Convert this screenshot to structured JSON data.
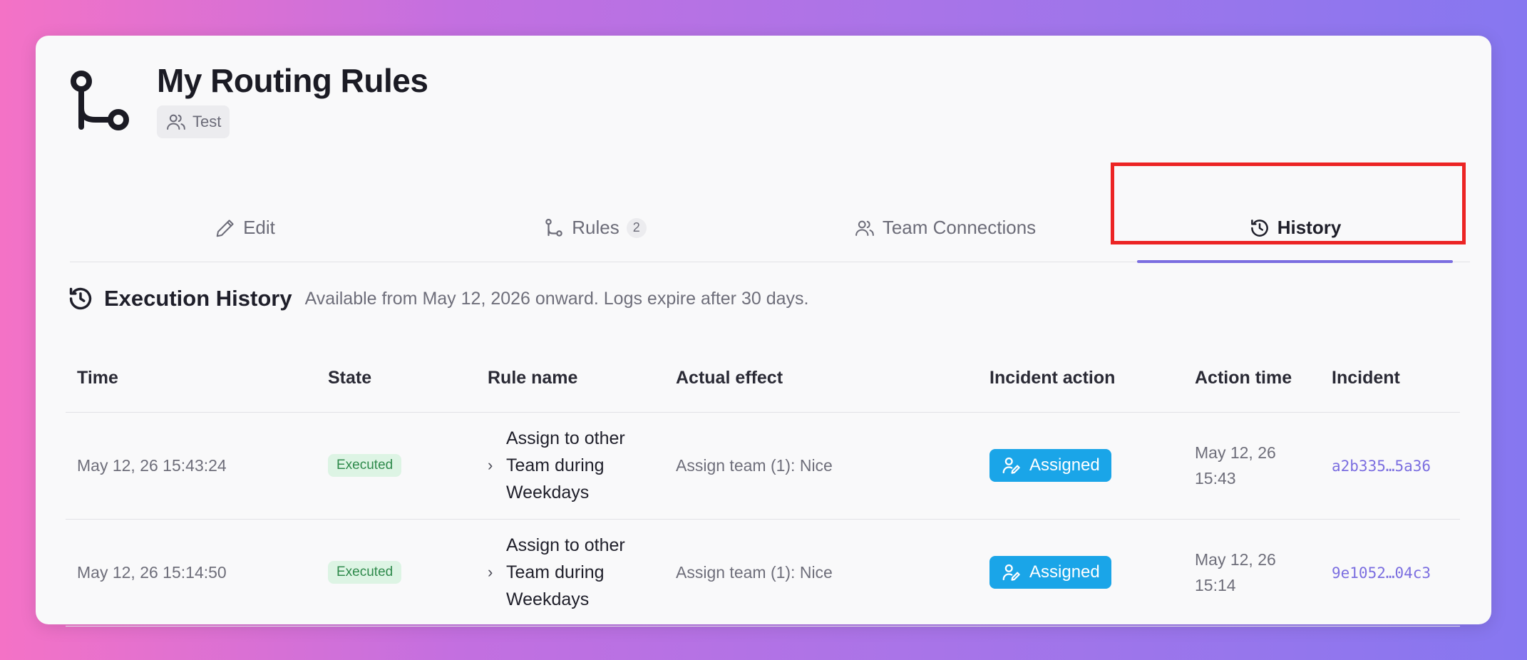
{
  "page": {
    "title": "My Routing Rules",
    "team_badge": "Test",
    "logo_icon": "git-branch-icon"
  },
  "tabs": [
    {
      "label": "Edit",
      "icon": "pencil-icon"
    },
    {
      "label": "Rules",
      "icon": "branch-icon",
      "count": "2"
    },
    {
      "label": "Team Connections",
      "icon": "users-icon"
    },
    {
      "label": "History",
      "icon": "history-icon",
      "active": true
    }
  ],
  "section": {
    "title": "Execution History",
    "subtitle": "Available from May 12, 2026 onward. Logs expire after 30 days."
  },
  "table": {
    "headers": [
      "Time",
      "State",
      "Rule name",
      "Actual effect",
      "Incident action",
      "Action time",
      "Incident"
    ],
    "rows": [
      {
        "time": "May 12, 26 15:43:24",
        "state": "Executed",
        "rule_name": "Assign to other Team during Weekdays",
        "effect": "Assign team (1): Nice",
        "action": "Assigned",
        "action_time": "May 12, 26 15:43",
        "incident": "a2b335…5a36"
      },
      {
        "time": "May 12, 26 15:14:50",
        "state": "Executed",
        "rule_name": "Assign to other Team during Weekdays",
        "effect": "Assign team (1): Nice",
        "action": "Assigned",
        "action_time": "May 12, 26 15:14",
        "incident": "9e1052…04c3"
      }
    ]
  },
  "colors": {
    "accent": "#7b6ee0",
    "assigned": "#1aa5e8",
    "executed_bg": "#ddf4e4",
    "executed_text": "#2f8a4c",
    "highlight": "#ec2424"
  }
}
